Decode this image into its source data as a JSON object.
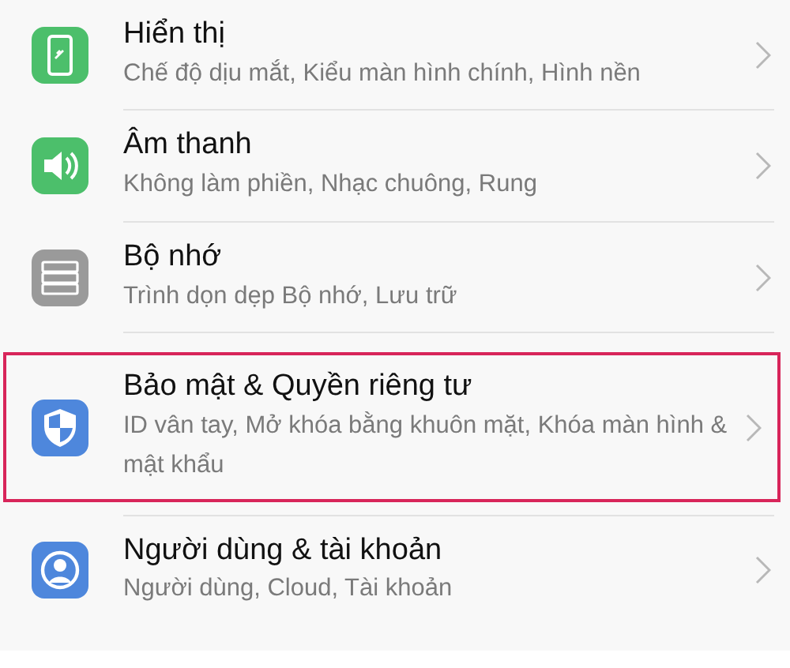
{
  "settings": [
    {
      "title": "Hiển thị",
      "subtitle": "Chế độ dịu mắt, Kiểu màn hình chính, Hình nền",
      "highlighted": false
    },
    {
      "title": "Âm thanh",
      "subtitle": "Không làm phiền, Nhạc chuông, Rung",
      "highlighted": false
    },
    {
      "title": "Bộ nhớ",
      "subtitle": "Trình dọn dẹp Bộ nhớ, Lưu trữ",
      "highlighted": false
    },
    {
      "title": "Bảo mật & Quyền riêng tư",
      "subtitle": "ID vân tay, Mở khóa bằng khuôn mặt, Khóa màn hình & mật khẩu",
      "highlighted": true
    },
    {
      "title": "Người dùng & tài khoản",
      "subtitle": "Người dùng, Cloud, Tài khoản",
      "highlighted": false
    }
  ]
}
